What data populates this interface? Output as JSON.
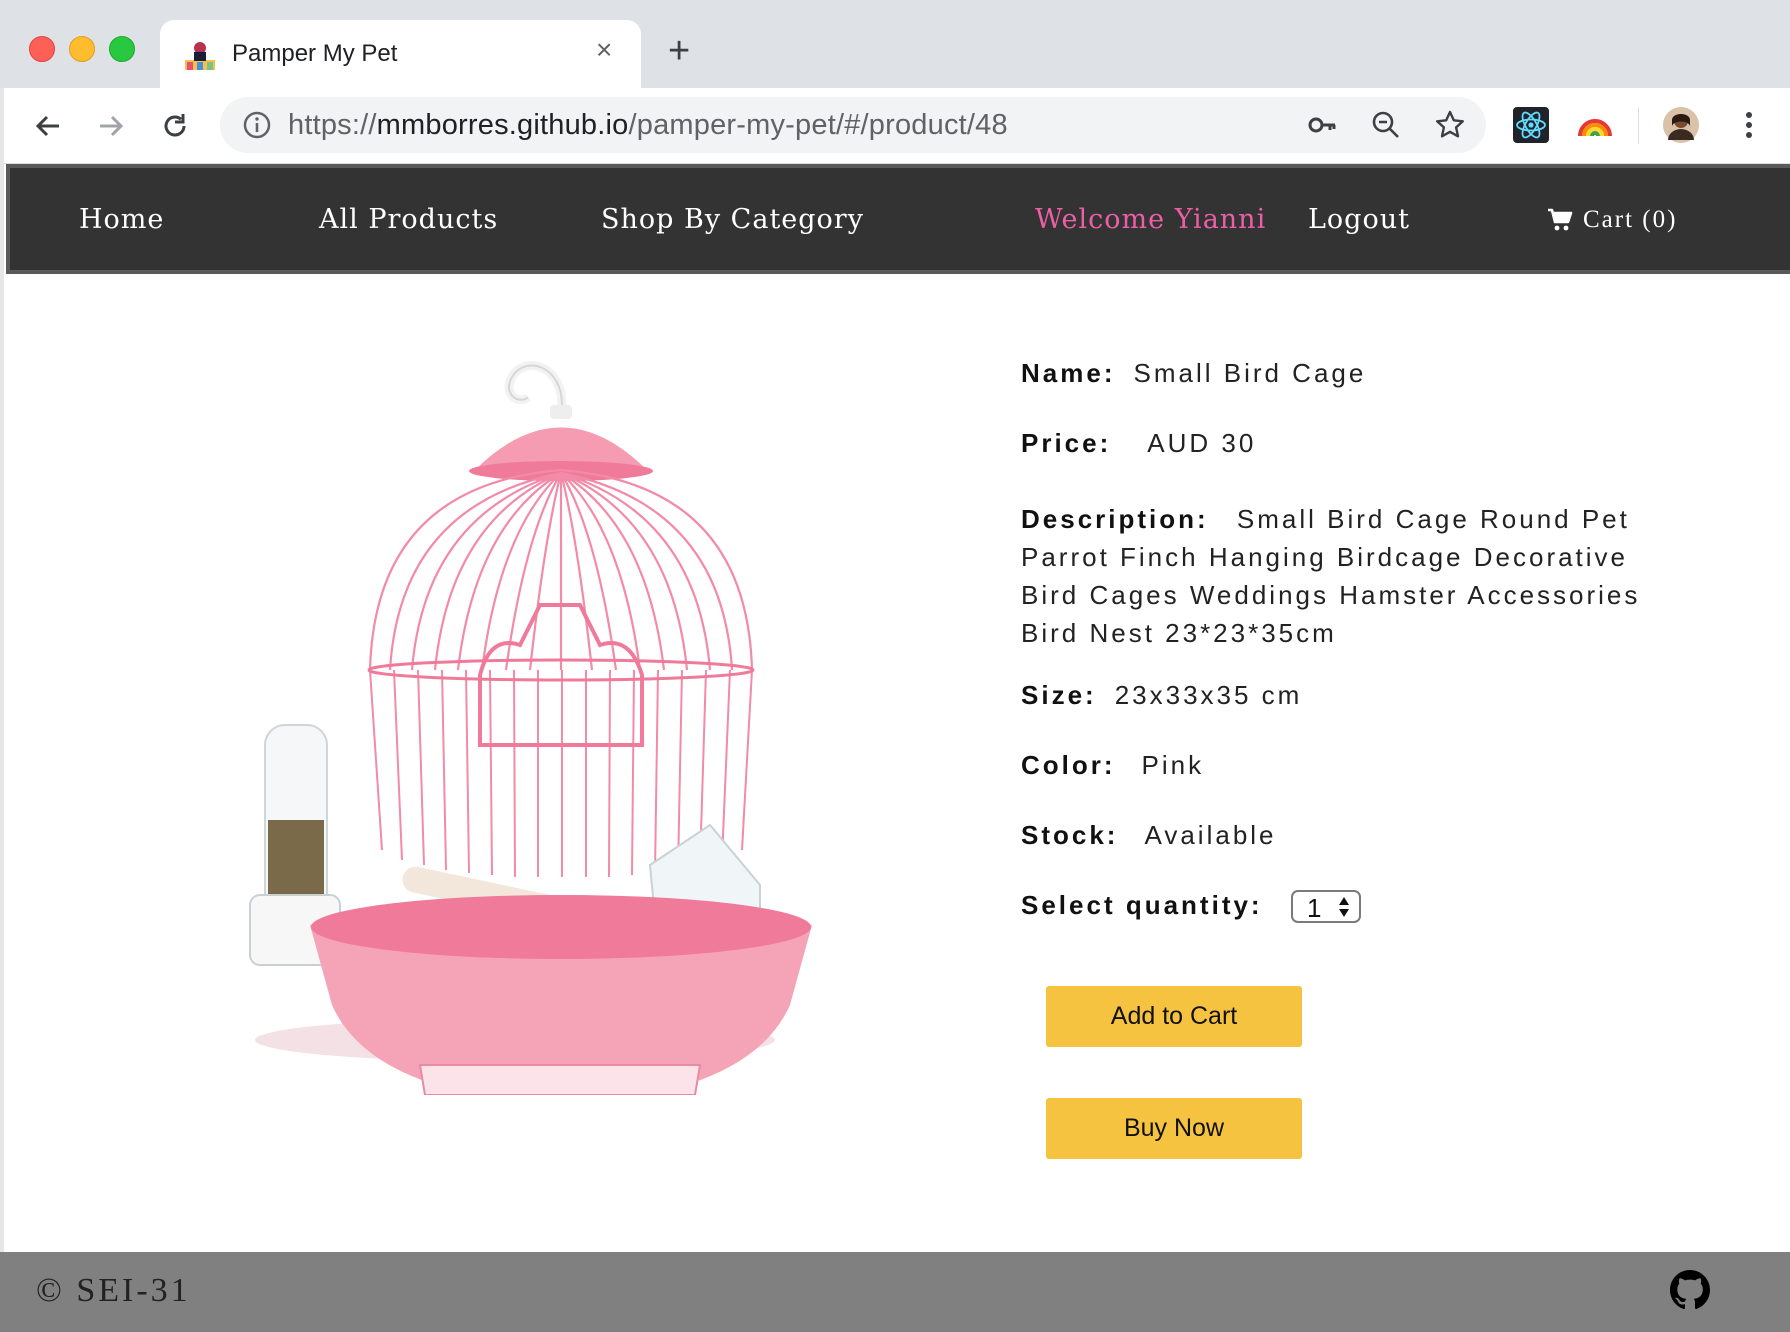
{
  "browser": {
    "tab_title": "Pamper My Pet",
    "tab_close": "×",
    "new_tab": "+",
    "url_scheme": "https://",
    "url_host": "mmborres.github.io",
    "url_path": "/pamper-my-pet/#/product/48",
    "icons": [
      "back-icon",
      "forward-icon",
      "reload-icon",
      "info-icon",
      "key-icon",
      "zoom-out-icon",
      "star-icon",
      "react-devtools-icon",
      "rainbow-extension-icon",
      "profile-avatar",
      "menu-kebab-icon"
    ]
  },
  "nav": {
    "home": "Home",
    "all_products": "All Products",
    "shop_by_category": "Shop By Category",
    "welcome": "Welcome Yianni",
    "logout": "Logout",
    "cart": "Cart (0)",
    "welcome_color": "#ec5fa6",
    "bar_color": "#333333"
  },
  "product": {
    "name_label": "Name:",
    "name": "Small Bird Cage",
    "price_label": "Price:",
    "price": "AUD 30",
    "description_label": "Description:",
    "description": "Small Bird Cage Round Pet Parrot Finch Hanging Birdcage Decorative Bird Cages Weddings Hamster Accessories Bird Nest 23*23*35cm",
    "size_label": "Size:",
    "size": "23x33x35 cm",
    "color_label": "Color:",
    "color": "Pink",
    "stock_label": "Stock:",
    "stock": "Available",
    "quantity_label": "Select quantity:",
    "quantity": "1",
    "image_icon": "pink-bird-cage-image"
  },
  "actions": {
    "add_to_cart": "Add to Cart",
    "buy_now": "Buy Now",
    "button_color": "#f5c33f"
  },
  "footer": {
    "copyright": "© SEI-31",
    "github_icon": "github-icon",
    "bg_color": "#808080"
  }
}
